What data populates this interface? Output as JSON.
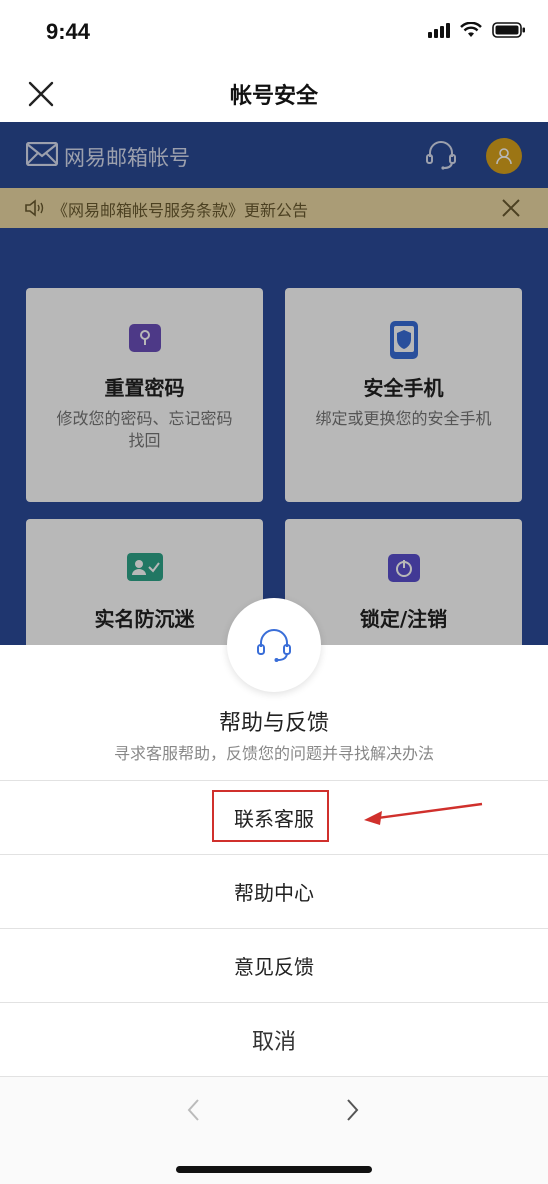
{
  "status": {
    "time": "9:44"
  },
  "nav": {
    "title": "帐号安全"
  },
  "brand": {
    "name": "网易邮箱帐号"
  },
  "notice": {
    "text": "《网易邮箱帐号服务条款》更新公告"
  },
  "cards": [
    {
      "title": "重置密码",
      "desc": "修改您的密码、忘记密码找回",
      "icon": "lock-icon",
      "color": "#6b4fbb"
    },
    {
      "title": "安全手机",
      "desc": "绑定或更换您的安全手机",
      "icon": "phone-shield-icon",
      "color": "#3a6ed8"
    },
    {
      "title": "实名防沉迷",
      "desc": "",
      "icon": "id-card-icon",
      "color": "#2fa58a"
    },
    {
      "title": "锁定/注销",
      "desc": "",
      "icon": "power-icon",
      "color": "#5a4fcf"
    }
  ],
  "sheet": {
    "title": "帮助与反馈",
    "subtitle": "寻求客服帮助，反馈您的问题并寻找解决办法",
    "options": [
      "联系客服",
      "帮助中心",
      "意见反馈"
    ],
    "cancel": "取消"
  },
  "colors": {
    "brand_blue": "#2c4c9a",
    "highlight_red": "#d0302c",
    "avatar_gold": "#d9a21c"
  }
}
